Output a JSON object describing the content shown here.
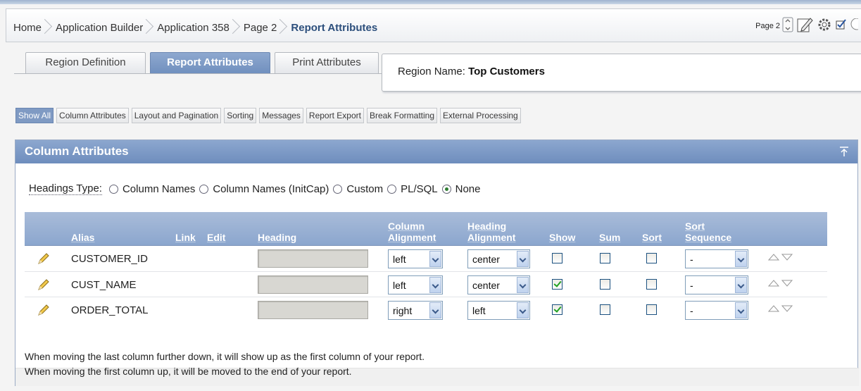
{
  "breadcrumb": {
    "items": [
      "Home",
      "Application Builder",
      "Application 358",
      "Page 2"
    ],
    "current": "Report Attributes"
  },
  "page_control": {
    "label": "Page 2"
  },
  "tabs": {
    "region_definition": "Region Definition",
    "report_attributes": "Report Attributes",
    "print_attributes": "Print Attributes"
  },
  "region": {
    "label": "Region Name:",
    "value": "Top Customers"
  },
  "subnav": [
    "Show All",
    "Column Attributes",
    "Layout and Pagination",
    "Sorting",
    "Messages",
    "Report Export",
    "Break Formatting",
    "External Processing"
  ],
  "panel": {
    "title": "Column Attributes"
  },
  "headings_type": {
    "label": "Headings Type:",
    "options": [
      "Column Names",
      "Column Names (InitCap)",
      "Custom",
      "PL/SQL",
      "None"
    ],
    "selected": "None"
  },
  "table": {
    "headers": {
      "alias": "Alias",
      "link": "Link",
      "edit": "Edit",
      "heading": "Heading",
      "col_align_1": "Column",
      "col_align_2": "Alignment",
      "head_align_1": "Heading",
      "head_align_2": "Alignment",
      "show": "Show",
      "sum": "Sum",
      "sort": "Sort",
      "sortseq_1": "Sort",
      "sortseq_2": "Sequence"
    },
    "rows": [
      {
        "alias": "CUSTOMER_ID",
        "heading": "",
        "column_alignment": "left",
        "heading_alignment": "center",
        "show": false,
        "sum": false,
        "sort": false,
        "sort_sequence": "-"
      },
      {
        "alias": "CUST_NAME",
        "heading": "",
        "column_alignment": "left",
        "heading_alignment": "center",
        "show": true,
        "sum": false,
        "sort": false,
        "sort_sequence": "-"
      },
      {
        "alias": "ORDER_TOTAL",
        "heading": "",
        "column_alignment": "right",
        "heading_alignment": "left",
        "show": true,
        "sum": false,
        "sort": false,
        "sort_sequence": "-"
      }
    ]
  },
  "notes": [
    "When moving the last column further down, it will show up as the first column of your report.",
    "When moving the first column up, it will be moved to the end of your report."
  ],
  "icons": [
    "pencil-icon",
    "move-up-icon",
    "move-down-icon",
    "collapse-icon",
    "gear-icon",
    "edit-page-icon",
    "page-nav-icon"
  ]
}
